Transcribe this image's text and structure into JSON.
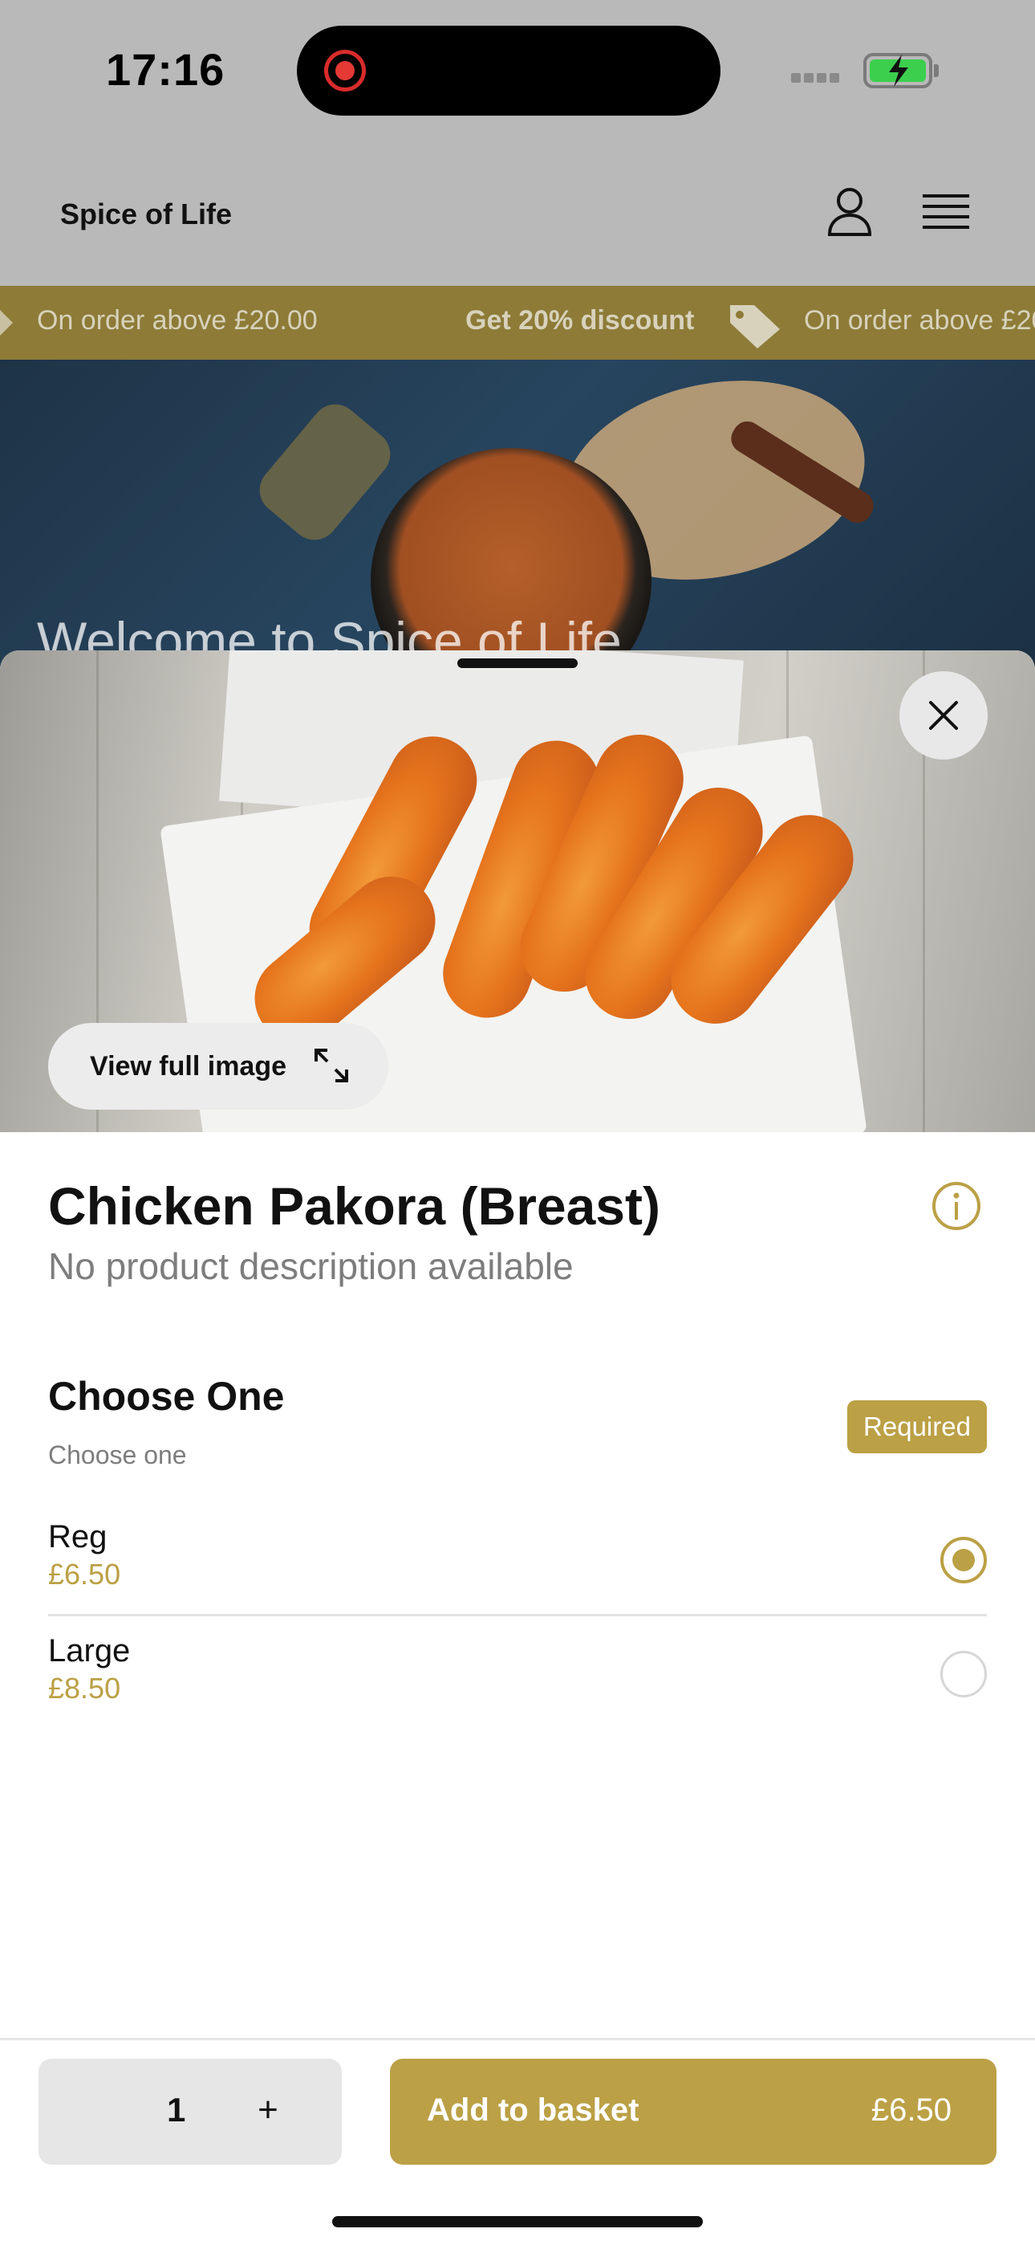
{
  "status_bar": {
    "time": "17:16"
  },
  "header": {
    "brand": "Spice of Life"
  },
  "promo": {
    "items": [
      "On order above £20.00",
      "Get 20% discount",
      "On order above £20.00"
    ]
  },
  "hero": {
    "title": "Welcome to Spice of Life"
  },
  "product": {
    "view_full_image_label": "View full image",
    "title": "Chicken Pakora (Breast)",
    "description": "No product description available"
  },
  "option_group": {
    "title": "Choose One",
    "subtitle": "Choose one",
    "badge": "Required",
    "options": [
      {
        "name": "Reg",
        "price": "£6.50",
        "selected": true
      },
      {
        "name": "Large",
        "price": "£8.50",
        "selected": false
      }
    ]
  },
  "footer": {
    "quantity": "1",
    "plus_symbol": "+",
    "add_label": "Add to basket",
    "add_price": "£6.50"
  },
  "colors": {
    "accent": "#bba045",
    "promo_bg": "#8d7b37",
    "overlay_gray": "#b9b9b9"
  }
}
